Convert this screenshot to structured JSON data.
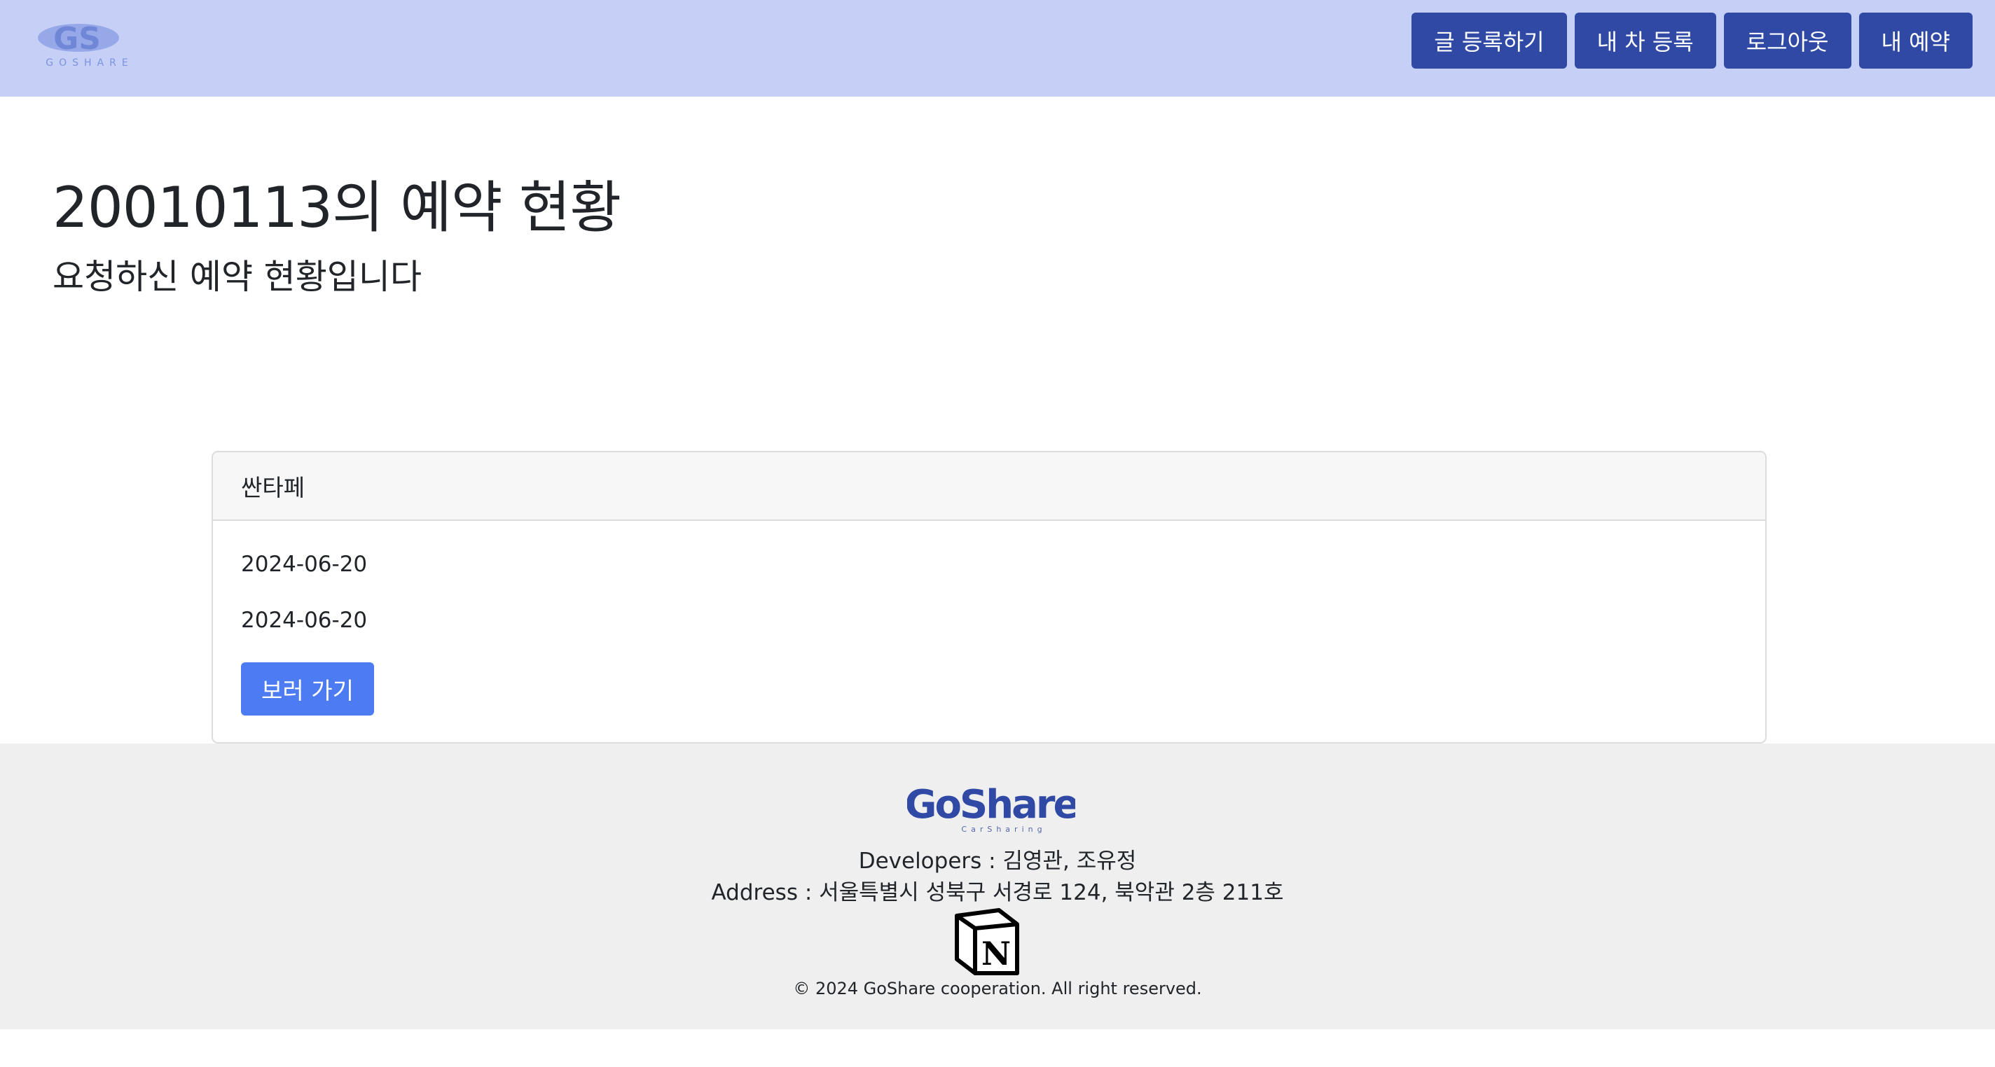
{
  "header": {
    "logo_alt": "GoShare",
    "logo_text": "GOSHARE",
    "nav": [
      {
        "label": "글 등록하기"
      },
      {
        "label": "내 차 등록"
      },
      {
        "label": "로그아웃"
      },
      {
        "label": "내 예약"
      }
    ]
  },
  "main": {
    "title": "20010113의 예약 현황",
    "subtitle": "요청하신 예약 현황입니다"
  },
  "reservation": {
    "car_name": "싼타페",
    "start_date": "2024-06-20",
    "end_date": "2024-06-20",
    "button_label": "보러 가기"
  },
  "footer": {
    "brand": "GoShare",
    "brand_tagline": "CarSharing",
    "developers": "Developers : 김영관, 조유정",
    "address": "Address : 서울특별시 성북구 서경로 124, 북악관 2층 211호",
    "copyright": "© 2024 GoShare cooperation. All right reserved."
  },
  "colors": {
    "navbar_bg": "#c6cff5",
    "nav_button": "#2f49a5",
    "primary_button": "#4d7cf2",
    "footer_bg": "#efefef"
  },
  "icons": {
    "header_logo": "goshare-logo-icon",
    "footer_logo": "goshare-wordmark-icon",
    "notion": "notion-icon"
  }
}
